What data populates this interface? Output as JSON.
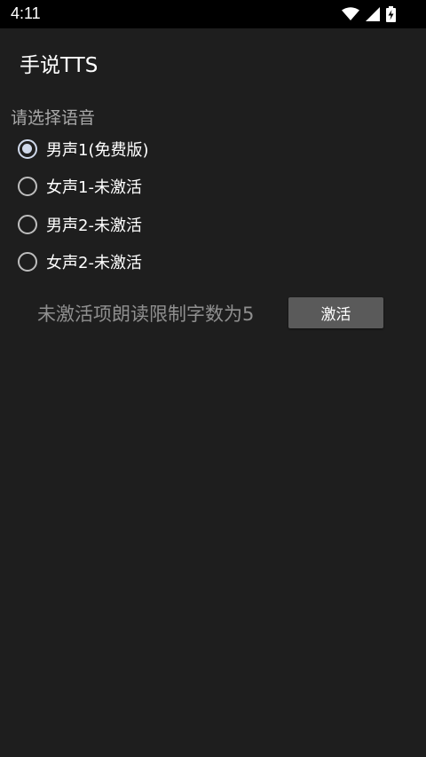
{
  "status_bar": {
    "time": "4:11",
    "icons": [
      "wifi-icon",
      "signal-icon",
      "battery-charging-icon"
    ]
  },
  "app_bar": {
    "title": "手说TTS"
  },
  "voice_section": {
    "label": "请选择语音",
    "options": [
      {
        "label": "男声1(免费版)",
        "selected": true
      },
      {
        "label": "女声1-未激活",
        "selected": false
      },
      {
        "label": "男声2-未激活",
        "selected": false
      },
      {
        "label": "女声2-未激活",
        "selected": false
      }
    ]
  },
  "activation": {
    "notice": "未激活项朗读限制字数为5",
    "button_label": "激活"
  },
  "colors": {
    "background": "#1e1e1e",
    "status_bar": "#000000",
    "button": "#5a5a5a",
    "radio_checked": "#cfd8ea"
  }
}
